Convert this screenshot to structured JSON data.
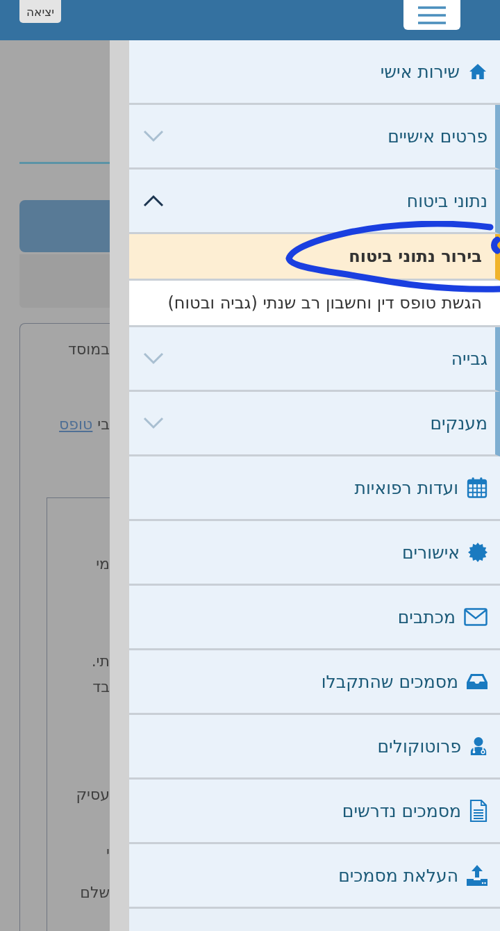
{
  "top_bar": {
    "exit_button": "יציאה"
  },
  "background_page": {
    "card_text": "במוסד",
    "link_line": {
      "text": "בי",
      "link": "טופס"
    },
    "inner_texts": [
      "מי",
      "תי.",
      "בד",
      "עסיק",
      "י",
      "שלם"
    ]
  },
  "menu": {
    "items": [
      {
        "kind": "link",
        "label": "שירות אישי"
      },
      {
        "kind": "group",
        "label": "פרטים אישיים",
        "expanded": false
      },
      {
        "kind": "group",
        "label": "נתוני ביטוח",
        "expanded": true,
        "children": [
          {
            "label": "בירור נתוני ביטוח",
            "selected": true
          },
          {
            "label": "הגשת טופס דין וחשבון רב שנתי (גביה ובטוח)",
            "selected": false
          }
        ]
      },
      {
        "kind": "group",
        "label": "גבייה",
        "expanded": false
      },
      {
        "kind": "group",
        "label": "מענקים",
        "expanded": false
      },
      {
        "kind": "link",
        "label": "ועדות רפואיות"
      },
      {
        "kind": "link",
        "label": "אישורים"
      },
      {
        "kind": "link",
        "label": "מכתבים"
      },
      {
        "kind": "link",
        "label": "מסמכים שהתקבלו"
      },
      {
        "kind": "link",
        "label": "פרוטוקולים"
      },
      {
        "kind": "link",
        "label": "מסמכים נדרשים"
      },
      {
        "kind": "link",
        "label": "העלאת מסמכים"
      }
    ]
  }
}
